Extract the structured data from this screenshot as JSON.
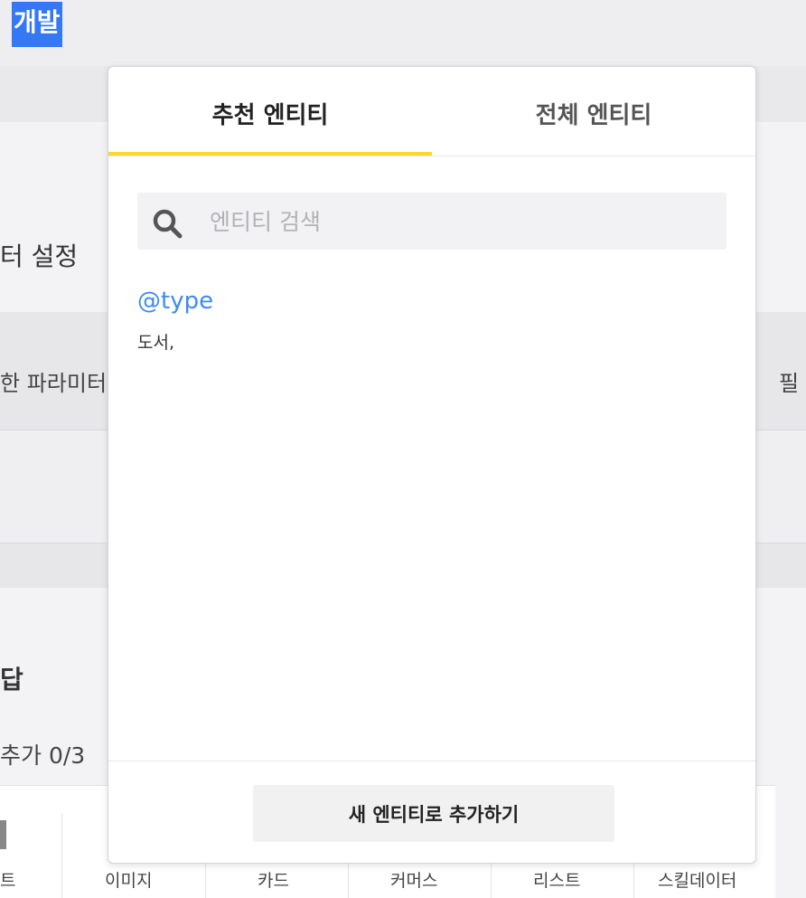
{
  "background": {
    "top_title": "개발",
    "setting_label": "터 설정",
    "param_header": "한 파라미터",
    "required_header": "필",
    "section_title": "답",
    "add_count": "추가 0/3",
    "type_tabs": [
      "트",
      "이미지",
      "카드",
      "커머스",
      "리스트",
      "스킬데이터"
    ]
  },
  "popup": {
    "tabs": [
      {
        "label": "추천 엔티티",
        "active": true
      },
      {
        "label": "전체 엔티티",
        "active": false
      }
    ],
    "search": {
      "placeholder": "엔티티 검색",
      "value": ""
    },
    "entities": [
      {
        "name": "@type",
        "values": "도서,"
      }
    ],
    "add_button_label": "새 엔티티로 추가하기"
  },
  "colors": {
    "accent_tab": "#fcd733",
    "entity_link": "#3d8af7",
    "selection": "#3478f6"
  }
}
